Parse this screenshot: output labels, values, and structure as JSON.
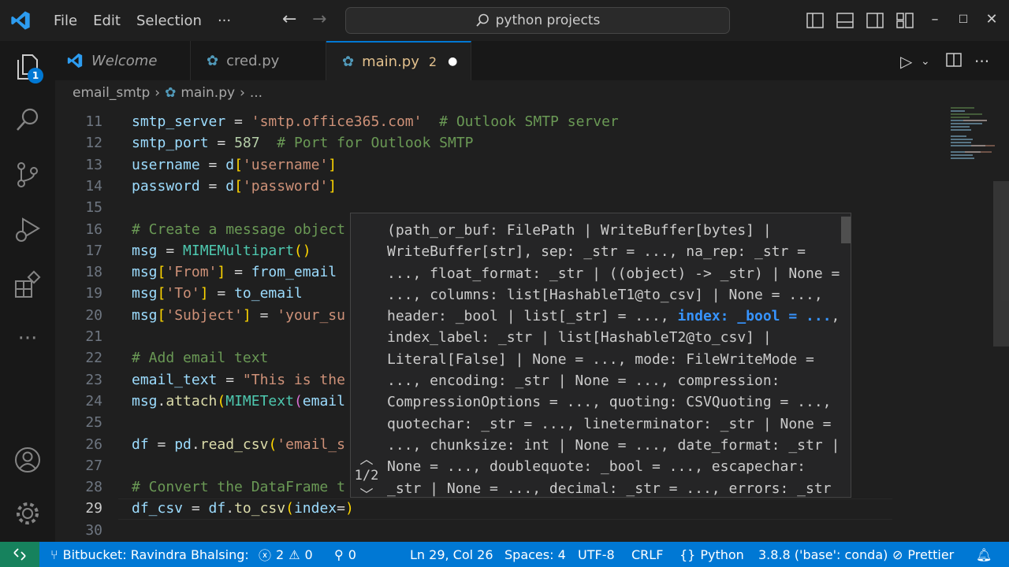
{
  "menu": {
    "file": "File",
    "edit": "Edit",
    "selection": "Selection",
    "more": "···"
  },
  "search": {
    "text": "python projects"
  },
  "tabs": [
    {
      "label": "Welcome"
    },
    {
      "label": "cred.py"
    },
    {
      "label": "main.py",
      "problems": "2"
    }
  ],
  "breadcrumb": {
    "folder": "email_smtp",
    "file": "main.py",
    "more": "..."
  },
  "activity": {
    "explorer_badge": "1"
  },
  "lines": [
    {
      "n": "11",
      "tokens": [
        [
          "t-var",
          "smtp_server"
        ],
        [
          "t-op",
          " = "
        ],
        [
          "t-str",
          "'smtp.office365.com'"
        ],
        [
          "t-op",
          "  "
        ],
        [
          "t-com",
          "# Outlook SMTP server"
        ]
      ]
    },
    {
      "n": "12",
      "tokens": [
        [
          "t-var",
          "smtp_port"
        ],
        [
          "t-op",
          " = "
        ],
        [
          "t-num",
          "587"
        ],
        [
          "t-op",
          "  "
        ],
        [
          "t-com",
          "# Port for Outlook SMTP"
        ]
      ]
    },
    {
      "n": "13",
      "tokens": [
        [
          "t-var",
          "username"
        ],
        [
          "t-op",
          " = "
        ],
        [
          "t-var",
          "d"
        ],
        [
          "t-par",
          "["
        ],
        [
          "t-str",
          "'username'"
        ],
        [
          "t-par",
          "]"
        ]
      ]
    },
    {
      "n": "14",
      "tokens": [
        [
          "t-var",
          "password"
        ],
        [
          "t-op",
          " = "
        ],
        [
          "t-var",
          "d"
        ],
        [
          "t-par",
          "["
        ],
        [
          "t-str",
          "'password'"
        ],
        [
          "t-par",
          "]"
        ]
      ]
    },
    {
      "n": "15",
      "tokens": []
    },
    {
      "n": "16",
      "tokens": [
        [
          "t-com",
          "# Create a message object"
        ]
      ]
    },
    {
      "n": "17",
      "tokens": [
        [
          "t-var",
          "msg"
        ],
        [
          "t-op",
          " = "
        ],
        [
          "t-cls",
          "MIMEMultipart"
        ],
        [
          "t-par",
          "()"
        ]
      ]
    },
    {
      "n": "18",
      "tokens": [
        [
          "t-var",
          "msg"
        ],
        [
          "t-par",
          "["
        ],
        [
          "t-str",
          "'From'"
        ],
        [
          "t-par",
          "]"
        ],
        [
          "t-op",
          " = "
        ],
        [
          "t-var",
          "from_email"
        ]
      ]
    },
    {
      "n": "19",
      "tokens": [
        [
          "t-var",
          "msg"
        ],
        [
          "t-par",
          "["
        ],
        [
          "t-str",
          "'To'"
        ],
        [
          "t-par",
          "]"
        ],
        [
          "t-op",
          " = "
        ],
        [
          "t-var",
          "to_email"
        ]
      ]
    },
    {
      "n": "20",
      "tokens": [
        [
          "t-var",
          "msg"
        ],
        [
          "t-par",
          "["
        ],
        [
          "t-str",
          "'Subject'"
        ],
        [
          "t-par",
          "]"
        ],
        [
          "t-op",
          " = "
        ],
        [
          "t-str",
          "'your_su"
        ]
      ]
    },
    {
      "n": "21",
      "tokens": []
    },
    {
      "n": "22",
      "tokens": [
        [
          "t-com",
          "# Add email text"
        ]
      ]
    },
    {
      "n": "23",
      "tokens": [
        [
          "t-var",
          "email_text"
        ],
        [
          "t-op",
          " = "
        ],
        [
          "t-str",
          "\"This is the"
        ]
      ]
    },
    {
      "n": "24",
      "tokens": [
        [
          "t-var",
          "msg"
        ],
        [
          "t-op",
          "."
        ],
        [
          "t-fn",
          "attach"
        ],
        [
          "t-par",
          "("
        ],
        [
          "t-cls",
          "MIMEText"
        ],
        [
          "t-par2",
          "("
        ],
        [
          "t-var",
          "email"
        ]
      ]
    },
    {
      "n": "25",
      "tokens": []
    },
    {
      "n": "26",
      "tokens": [
        [
          "t-var",
          "df"
        ],
        [
          "t-op",
          " = "
        ],
        [
          "t-var",
          "pd"
        ],
        [
          "t-op",
          "."
        ],
        [
          "t-fn",
          "read_csv"
        ],
        [
          "t-par",
          "("
        ],
        [
          "t-str",
          "'email_s"
        ]
      ]
    },
    {
      "n": "27",
      "tokens": []
    },
    {
      "n": "28",
      "tokens": [
        [
          "t-com",
          "# Convert the DataFrame t"
        ]
      ]
    },
    {
      "n": "29",
      "tokens": [
        [
          "t-var",
          "df_csv"
        ],
        [
          "t-op",
          " = "
        ],
        [
          "t-var",
          "df"
        ],
        [
          "t-op",
          "."
        ],
        [
          "t-fn",
          "to_csv"
        ],
        [
          "t-par",
          "("
        ],
        [
          "t-var",
          "index"
        ],
        [
          "t-op",
          "="
        ],
        [
          "t-par",
          ")"
        ]
      ]
    },
    {
      "n": "30",
      "tokens": []
    }
  ],
  "signature": {
    "before": "(path_or_buf: FilePath | WriteBuffer[bytes] | WriteBuffer[str], sep: _str = ..., na_rep: _str = ..., float_format: _str | ((object) -> _str) | None = ..., columns: list[HashableT1@to_csv] | None = ..., header: _bool | list[_str] = ..., ",
    "active": "index: _bool = ...",
    "after": ", index_label: _str | list[HashableT2@to_csv] | Literal[False] | None = ..., mode: FileWriteMode = ..., encoding: _str | None = ..., compression: CompressionOptions = ..., quoting: CSVQuoting = ..., quotechar: _str = ..., lineterminator: _str | None = ..., chunksize: int | None = ..., date_format: _str | None = ..., doublequote: _bool = ..., escapechar: _str | None = ..., decimal: _str = ..., errors: _str",
    "overload": "1/2"
  },
  "status": {
    "bitbucket": "Bitbucket: Ravindra Bhalsing:",
    "errors": "2",
    "warnings": "0",
    "ports": "0",
    "position": "Ln 29, Col 26",
    "spaces": "Spaces: 4",
    "encoding": "UTF-8",
    "eol": "CRLF",
    "language": "Python",
    "interpreter": "3.8.8 ('base': conda)",
    "formatter": "Prettier"
  },
  "colors": {
    "accent": "#0078d4",
    "remote": "#16825d",
    "modified_tab": "#e2c08d"
  }
}
